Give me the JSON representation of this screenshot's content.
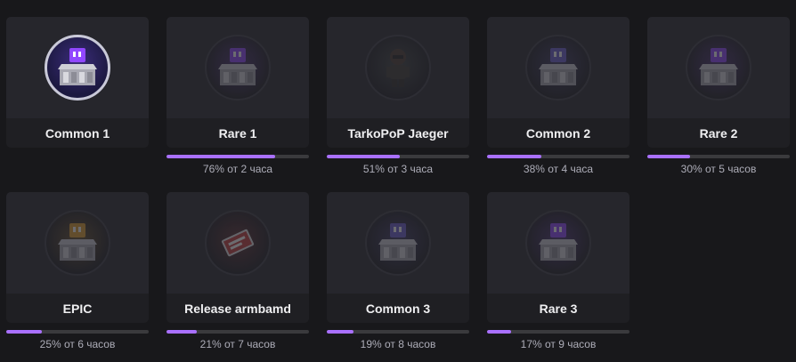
{
  "drops": [
    {
      "name": "Common 1",
      "icon": "twitch-crate-icon",
      "accent": "#9147ff",
      "claimed": true
    },
    {
      "name": "Rare 1",
      "icon": "twitch-crate-icon",
      "accent": "#9147ff",
      "claimed": false,
      "progress": 0.76,
      "progress_text": "76% от 2 часа"
    },
    {
      "name": "TarkoPoP Jaeger",
      "icon": "jaeger-figure-icon",
      "accent": "#6b7a6b",
      "claimed": false,
      "progress": 0.51,
      "progress_text": "51% от 3 часа"
    },
    {
      "name": "Common 2",
      "icon": "twitch-crate-icon",
      "accent": "#6c5fd0",
      "claimed": false,
      "progress": 0.38,
      "progress_text": "38% от 4 часа"
    },
    {
      "name": "Rare 2",
      "icon": "twitch-crate-icon",
      "accent": "#9147ff",
      "claimed": false,
      "progress": 0.3,
      "progress_text": "30% от 5 часов"
    },
    {
      "name": "EPIC",
      "icon": "twitch-crate-icon",
      "accent": "#e0a030",
      "claimed": false,
      "progress": 0.25,
      "progress_text": "25% от 6 часов"
    },
    {
      "name": "Release armbamd",
      "icon": "armband-icon",
      "accent": "#c43c3c",
      "claimed": false,
      "progress": 0.21,
      "progress_text": "21% от 7 часов"
    },
    {
      "name": "Common 3",
      "icon": "twitch-crate-icon",
      "accent": "#6c5fd0",
      "claimed": false,
      "progress": 0.19,
      "progress_text": "19% от 8 часов"
    },
    {
      "name": "Rare 3",
      "icon": "twitch-crate-icon",
      "accent": "#9147ff",
      "claimed": false,
      "progress": 0.17,
      "progress_text": "17% от 9 часов"
    }
  ],
  "colors": {
    "progress_fill": "#a970ff",
    "progress_track": "#3a3a3d"
  }
}
